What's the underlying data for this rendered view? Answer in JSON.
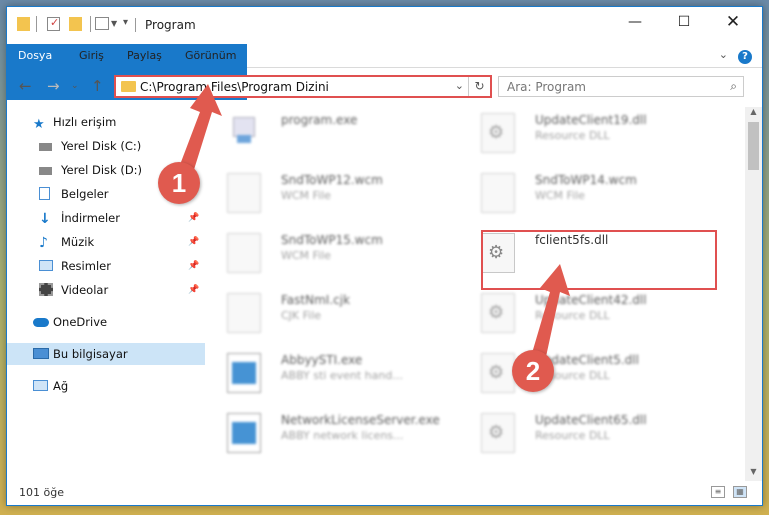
{
  "window": {
    "title": "Program"
  },
  "ribbon": {
    "tabs": [
      "Dosya",
      "Giriş",
      "Paylaş",
      "Görünüm"
    ],
    "help": "?"
  },
  "navbar": {
    "path": "C:\\Program Files\\Program Dizini",
    "search_placeholder": "Ara: Program"
  },
  "sidebar": {
    "items": [
      {
        "label": "Hızlı erişim",
        "icon": "star-icon",
        "color": "#1979ca"
      },
      {
        "label": "Yerel Disk (C:)",
        "icon": "drive-icon",
        "color": "#555555"
      },
      {
        "label": "Yerel Disk (D:)",
        "icon": "drive-icon",
        "color": "#555555"
      },
      {
        "label": "Belgeler",
        "icon": "documents-icon",
        "color": "#4a8fd4"
      },
      {
        "label": "İndirmeler",
        "icon": "downloads-icon",
        "color": "#1979ca"
      },
      {
        "label": "Müzik",
        "icon": "music-icon",
        "color": "#1979ca"
      },
      {
        "label": "Resimler",
        "icon": "pictures-icon",
        "color": "#4a8fd4"
      },
      {
        "label": "Videolar",
        "icon": "videos-icon",
        "color": "#444444"
      },
      {
        "label": "OneDrive",
        "icon": "cloud-icon",
        "color": "#1979ca"
      },
      {
        "label": "Bu bilgisayar",
        "icon": "computer-icon",
        "color": "#4a8fd4"
      },
      {
        "label": "Ağ",
        "icon": "network-icon",
        "color": "#4a8fd4"
      }
    ]
  },
  "files": {
    "left": [
      {
        "name": "program.exe",
        "type": ""
      },
      {
        "name": "SndToWP12.wcm",
        "type": "WCM File"
      },
      {
        "name": "SndToWP15.wcm",
        "type": "WCM File"
      },
      {
        "name": "FastNmI.cjk",
        "type": "CJK File"
      },
      {
        "name": "AbbyySTI.exe",
        "type": "ABBY sti event hand..."
      },
      {
        "name": "NetworkLicenseServer.exe",
        "type": "ABBY network licens..."
      }
    ],
    "right": [
      {
        "name": "UpdateClient19.dll",
        "type": "Resource DLL"
      },
      {
        "name": "SndToWP14.wcm",
        "type": "WCM File"
      },
      {
        "name": "fclient5fs.dll",
        "type": ""
      },
      {
        "name": "UpdateClient42.dll",
        "type": "Resource DLL"
      },
      {
        "name": "UpdateClient5.dll",
        "type": "Resource DLL"
      },
      {
        "name": "UpdateClient65.dll",
        "type": "Resource DLL"
      }
    ]
  },
  "status": {
    "item_count": "101 öğe"
  },
  "annotations": {
    "marker1": "1",
    "marker2": "2",
    "color": "#e05a4f"
  }
}
